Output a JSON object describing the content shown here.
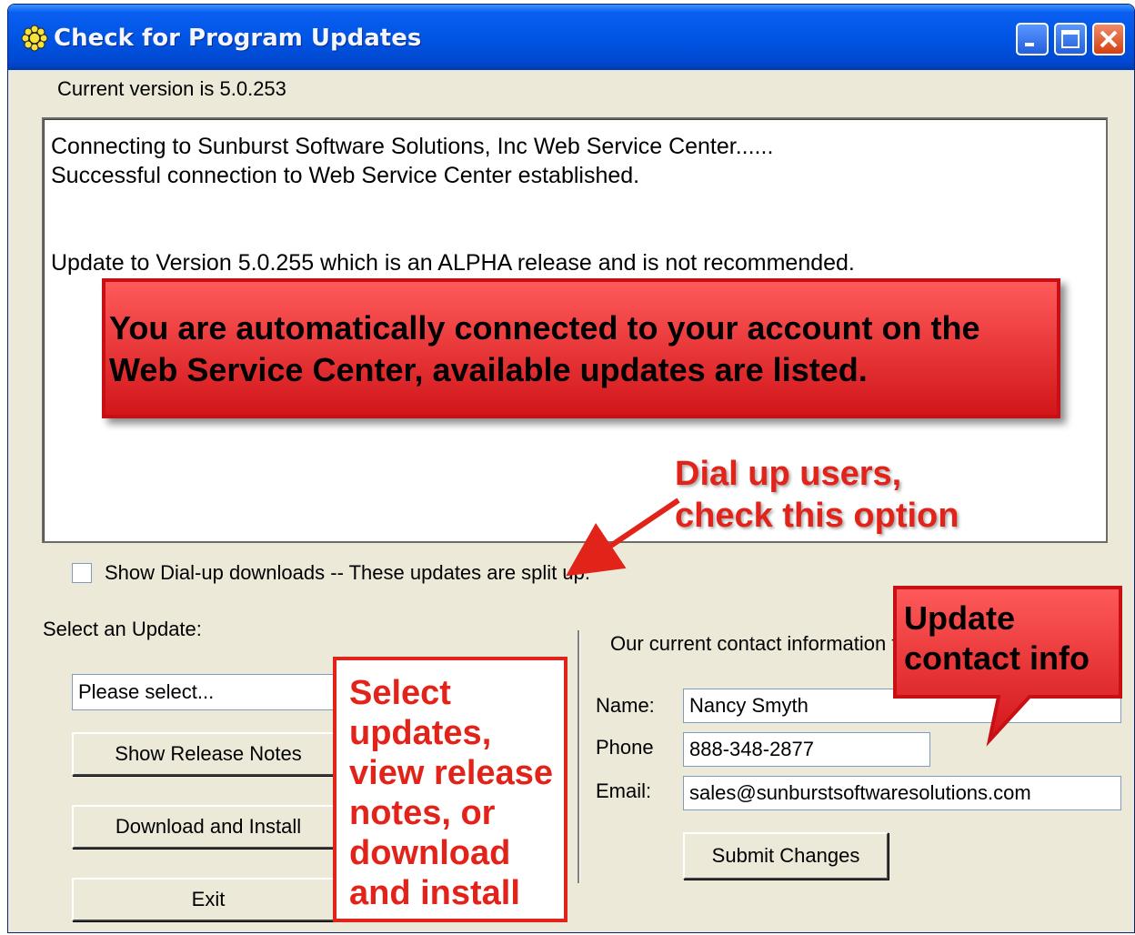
{
  "window": {
    "title": "Check for Program Updates",
    "title_icon": "gear-sun-icon",
    "controls": [
      "minimize-icon",
      "maximize-icon",
      "close-icon"
    ]
  },
  "version_text": "Current version is 5.0.253",
  "log": {
    "lines": [
      "Connecting to Sunburst Software Solutions, Inc Web Service Center......",
      "Successful connection to Web Service Center established.",
      "Update to Version 5.0.255 which is an ALPHA release and is not recommended."
    ]
  },
  "dialup": {
    "checked": false,
    "label": "Show Dial-up downloads -- These updates are split up."
  },
  "update_section": {
    "label": "Select an Update:",
    "select_value": "Please select...",
    "show_notes_button": "Show Release Notes",
    "download_button": "Download and Install",
    "exit_button": "Exit"
  },
  "contact": {
    "heading": "Our current contact information fo",
    "name_label": "Name:",
    "name_value": "Nancy Smyth",
    "phone_label": "Phone",
    "phone_value": "888-348-2877",
    "email_label": "Email:",
    "email_value": "sales@sunburstsoftwaresolutions.com",
    "submit_button": "Submit Changes"
  },
  "annotations": {
    "connected": "You are automatically connected to your account on the\nWeb Service Center, available updates are listed.",
    "dialup": "Dial up users,\ncheck this option",
    "select_updates": "Select\nupdates,\nview release\nnotes, or\ndownload\nand install",
    "update_contact": "Update\ncontact info"
  },
  "colors": {
    "titlebar": "#0055e5",
    "window_bg": "#ece9d8",
    "callout_red": "#e2231a"
  }
}
